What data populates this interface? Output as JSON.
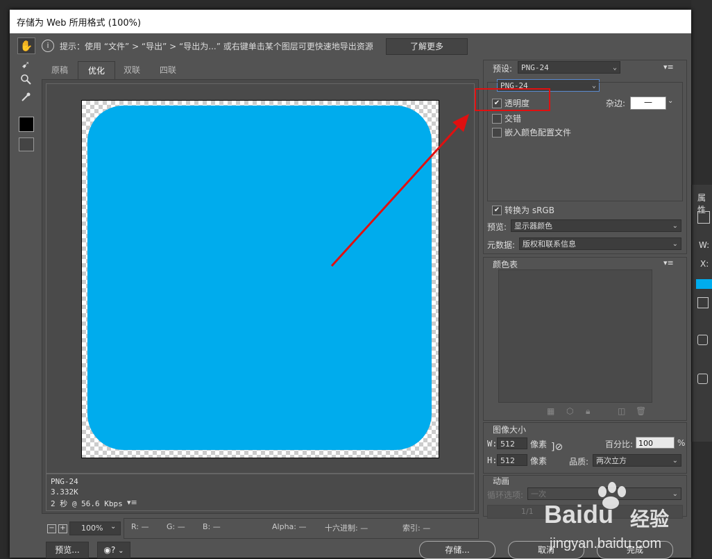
{
  "window": {
    "title": "存储为 Web 所用格式 (100%)"
  },
  "hint": {
    "text": "提示：使用 “文件” > “导出” > “导出为...” 或右键单击某个图层可更快速地导出资源",
    "learn_more": "了解更多"
  },
  "tabs": [
    {
      "label": "原稿"
    },
    {
      "label": "优化"
    },
    {
      "label": "双联"
    },
    {
      "label": "四联"
    }
  ],
  "info": {
    "format": "PNG-24",
    "size": "3.332K",
    "time": "2 秒 @ 56.6 Kbps"
  },
  "status": {
    "zoom": "100%",
    "r": "R: —",
    "g": "G: —",
    "b": "B: —",
    "alpha": "Alpha: —",
    "hex": "十六进制: —",
    "index": "索引: —"
  },
  "buttons": {
    "preview": "预览...",
    "save": "存储...",
    "cancel": "取消",
    "done": "完成"
  },
  "preset": {
    "label": "预设:",
    "value": "PNG-24",
    "format": "PNG-24",
    "transparency": "透明度",
    "matte_label": "杂边:",
    "matte_value": "—",
    "interlaced": "交错",
    "embed_profile": "嵌入颜色配置文件",
    "convert_srgb": "转换为 sRGB",
    "preview_label": "预览:",
    "preview_value": "显示器颜色",
    "metadata_label": "元数据:",
    "metadata_value": "版权和联系信息"
  },
  "color_table": {
    "label": "颜色表"
  },
  "image_size": {
    "label": "图像大小",
    "w_label": "W:",
    "w": "512",
    "h_label": "H:",
    "h": "512",
    "unit": "像素",
    "percent_label": "百分比:",
    "percent": "100",
    "percent_unit": "%",
    "quality_label": "品质:",
    "quality": "两次立方"
  },
  "animation": {
    "label": "动画",
    "loop_label": "循环选项:",
    "loop_value": "一次",
    "frame": "1/1"
  },
  "behind_panel": {
    "title": "属性",
    "w_label": "W:",
    "x_label": "X:"
  },
  "watermark": {
    "brand": "Baidu",
    "brand_cn": "经验",
    "url": "jingyan.baidu.com"
  },
  "colors": {
    "icon": "#00aced",
    "annotation": "#e01010"
  }
}
